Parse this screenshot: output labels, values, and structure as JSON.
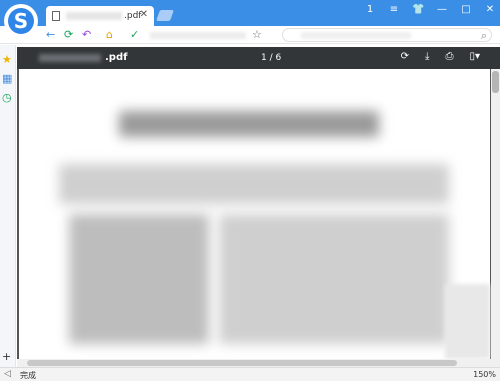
{
  "browser": {
    "tab": {
      "title": ".pdf"
    },
    "window_controls": [
      "1",
      "≡",
      "👕",
      "—",
      "□",
      "✕"
    ],
    "toolbar": {
      "back_icon": "←",
      "refresh_icon": "⟳",
      "undo_icon": "↶",
      "home_icon": "⌂",
      "shield_icon": "✓",
      "star_icon": "☆",
      "search_icon": "⌕"
    },
    "sidebar": {
      "items": [
        "★",
        "▦",
        "◷"
      ],
      "add": "+"
    }
  },
  "pdf": {
    "file_name": ".pdf",
    "page_indicator": "1 / 6",
    "tools": [
      "⟳",
      "⤓",
      "⎙",
      "▯▾"
    ]
  },
  "status": {
    "text": "完成",
    "zoom": "150%"
  },
  "colors": {
    "titlebar": "#3a8ee6",
    "pdf_header": "#323639",
    "pdf_background": "#525659"
  }
}
